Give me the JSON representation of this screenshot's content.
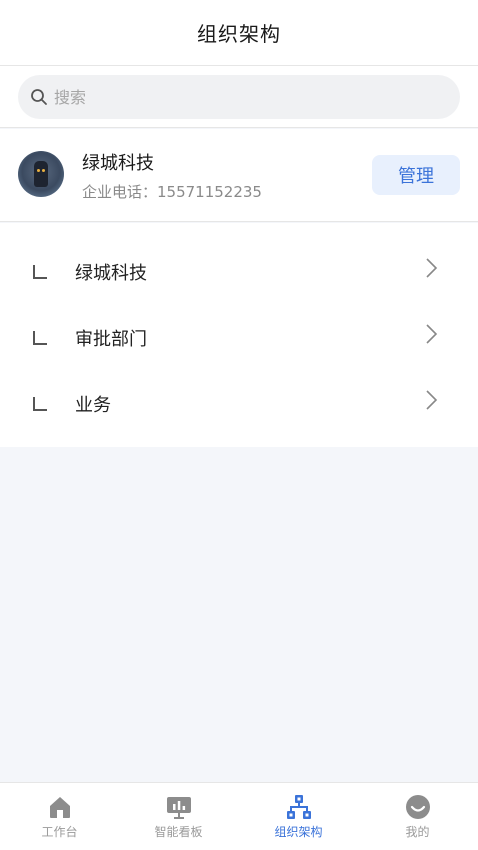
{
  "header": {
    "title": "组织架构"
  },
  "search": {
    "placeholder": "搜索"
  },
  "company": {
    "name": "绿城科技",
    "phone": "企业电话：15571152235",
    "manage_label": "管理"
  },
  "departments": [
    {
      "label": "绿城科技"
    },
    {
      "label": "审批部门"
    },
    {
      "label": "业务"
    }
  ],
  "tabbar": {
    "items": [
      {
        "label": "工作台",
        "icon": "home-icon"
      },
      {
        "label": "智能看板",
        "icon": "dashboard-icon"
      },
      {
        "label": "组织架构",
        "icon": "org-chart-icon",
        "active": true
      },
      {
        "label": "我的",
        "icon": "profile-icon"
      }
    ],
    "active_color": "#3b73d9",
    "inactive_color": "#9a9a9a"
  },
  "colors": {
    "accent": "#3b73d9",
    "manage_bg": "#e8f0fd",
    "page_bg": "#f4f6fa"
  }
}
